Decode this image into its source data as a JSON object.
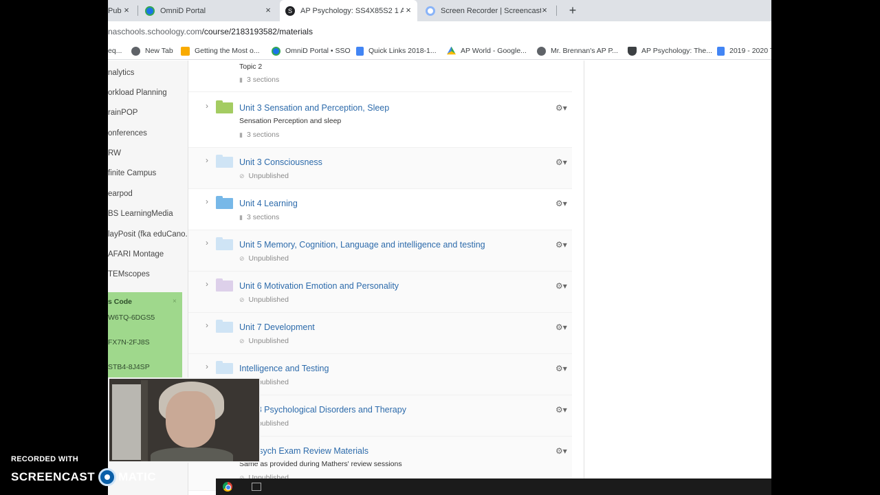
{
  "browser": {
    "tabs": [
      {
        "title": "Pub",
        "favicon_color": "#5f6368"
      },
      {
        "title": "OmniD Portal",
        "favicon_color": "#1a73e8"
      },
      {
        "title": "AP Psychology: SS4X85S2 1 AP P",
        "favicon_color": "#202124"
      },
      {
        "title": "Screen Recorder | Screencast-O",
        "favicon_color": "#8ab4f8"
      }
    ],
    "close_glyph": "×",
    "new_tab_glyph": "+",
    "url_dim": "naschools.schoology.com",
    "url_path": "/course/2183193582/materials",
    "bookmarks": [
      {
        "label": "eq...",
        "icon_color": "#5f6368"
      },
      {
        "label": "New Tab",
        "icon_color": "#5f6368"
      },
      {
        "label": "Getting the Most o...",
        "icon_color": "#f9ab00"
      },
      {
        "label": "OmniD Portal • SSO",
        "icon_color": "#1a73e8"
      },
      {
        "label": "Quick Links 2018-1...",
        "icon_color": "#4285f4"
      },
      {
        "label": "AP World - Google...",
        "icon_color": "#34a853"
      },
      {
        "label": "Mr. Brennan's AP P...",
        "icon_color": "#5f6368"
      },
      {
        "label": "AP Psychology: The...",
        "icon_color": "#3c4043"
      },
      {
        "label": "2019 - 2020 T",
        "icon_color": "#4285f4"
      }
    ]
  },
  "sidebar": {
    "items": [
      "nalytics",
      "orkload Planning",
      "rainPOP",
      "onferences",
      "RW",
      "finite Campus",
      "earpod",
      "BS LearningMedia",
      "layPosit (fka eduCano...",
      "AFARI Montage",
      "TEMscopes"
    ],
    "access_title": "s Code",
    "access_close": "×",
    "access_codes": [
      "W6TQ-6DGS5",
      "FX7N-2FJ8S",
      "STB4-8J4SP"
    ]
  },
  "materials": {
    "top_partial": {
      "subtitle": "Topic 2",
      "meta": "3 sections"
    },
    "rows": [
      {
        "title": "Unit 3 Sensation and Perception, Sleep",
        "subtitle": "Sensation Perception and sleep",
        "meta": "3 sections",
        "folder_color": "#a4cc62",
        "published": true
      },
      {
        "title": "Unit 3 Consciousness",
        "subtitle": "",
        "meta": "Unpublished",
        "folder_color": "#cfe4f5",
        "published": false
      },
      {
        "title": "Unit 4 Learning",
        "subtitle": "",
        "meta": "3 sections",
        "folder_color": "#77b8e8",
        "published": true
      },
      {
        "title": "Unit 5 Memory, Cognition, Language and intelligence and testing",
        "subtitle": "",
        "meta": "Unpublished",
        "folder_color": "#cfe4f5",
        "published": false
      },
      {
        "title": "Unit 6 Motivation Emotion and Personality",
        "subtitle": "",
        "meta": "Unpublished",
        "folder_color": "#ddd0ea",
        "published": false
      },
      {
        "title": "Unit 7 Development",
        "subtitle": "",
        "meta": "Unpublished",
        "folder_color": "#cfe4f5",
        "published": false
      },
      {
        "title": "Intelligence and Testing",
        "subtitle": "",
        "meta": "Unpublished",
        "folder_color": "#cfe4f5",
        "published": false
      },
      {
        "title": "Unit 8 Psychological Disorders and Therapy",
        "subtitle": "",
        "meta": "Unpublished",
        "folder_color": "#cfe4f5",
        "published": false
      },
      {
        "title": "AP Psych Exam Review Materials",
        "subtitle": "Same as provided during Mathers' review sessions",
        "meta": "Unpublished",
        "folder_color": "#cfe4f5",
        "published": false
      }
    ],
    "chevron_glyph": "›",
    "gear_glyph": "⚙▾",
    "published_icon": "▮",
    "unpublished_icon": "⊘"
  },
  "watermark": {
    "line1": "RECORDED WITH",
    "line2a": "SCREENCAST",
    "line2b": "MATIC"
  },
  "taskbar": {
    "up_glyph": "⌃",
    "net_glyph": "▚"
  }
}
